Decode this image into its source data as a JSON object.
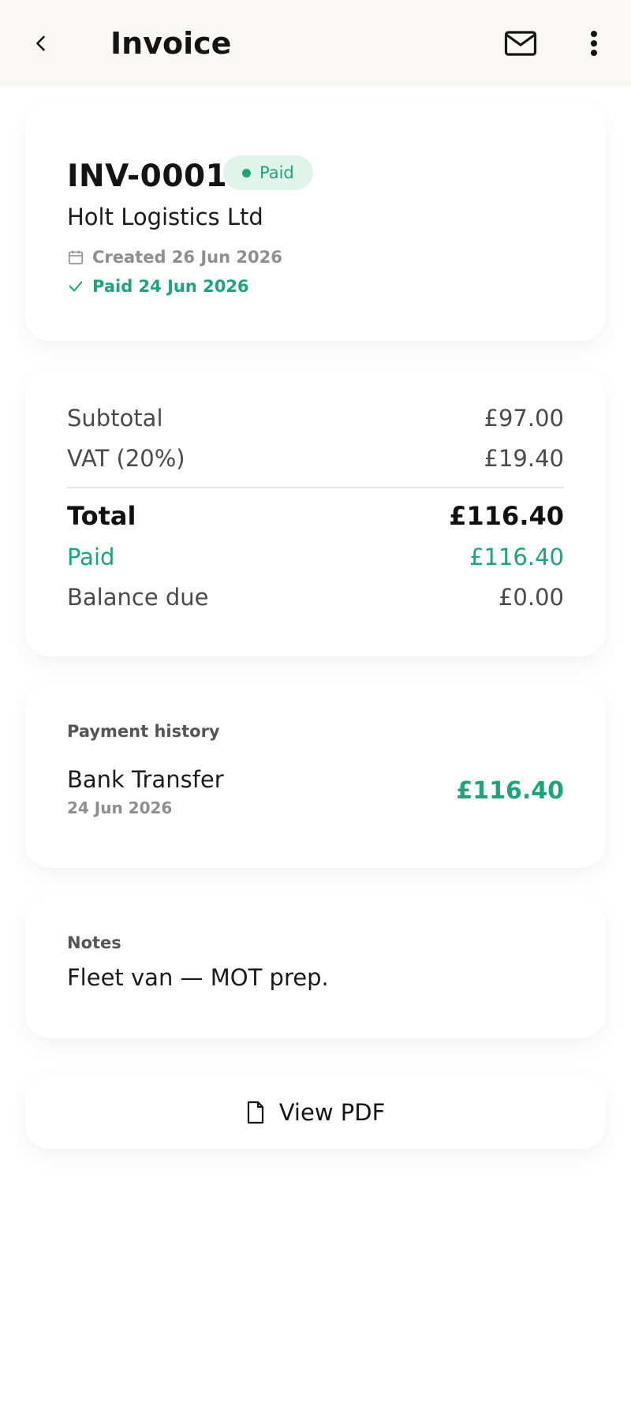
{
  "app_bar": {
    "title": "Invoice",
    "back_icon": "chevron-left-icon",
    "email_icon": "mail-icon",
    "menu_icon": "more-vertical-icon"
  },
  "invoice": {
    "number": "INV-0001",
    "status": "Paid",
    "client": "Holt Logistics Ltd",
    "created": "Created 26 Jun 2026",
    "paid_on": "Paid 24 Jun 2026"
  },
  "summary": {
    "rows": [
      {
        "label": "Subtotal",
        "value": "£97.00"
      },
      {
        "label": "VAT (20%)",
        "value": "£19.40"
      },
      {
        "label": "Total",
        "value": "£116.40"
      },
      {
        "label": "Paid",
        "value": "£116.40"
      },
      {
        "label": "Balance due",
        "value": "£0.00"
      }
    ]
  },
  "payments": {
    "heading": "Payment history",
    "items": [
      {
        "method": "Bank Transfer",
        "date": "24 Jun 2026",
        "amount": "£116.40"
      }
    ]
  },
  "notes": {
    "heading": "Notes",
    "text": "Fleet van — MOT prep."
  },
  "actions": {
    "view_pdf": "View PDF"
  },
  "colors": {
    "accent_green": "#1ea37a",
    "badge_bg": "#e1f4ec",
    "app_bar_bg": "#f9f8f6"
  }
}
